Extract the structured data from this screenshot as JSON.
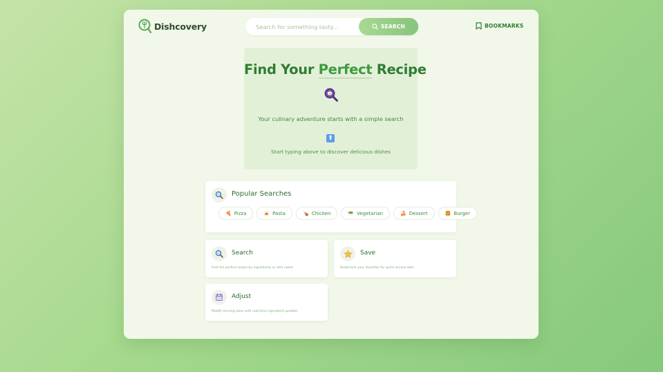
{
  "app": {
    "name": "Dishcovery"
  },
  "header": {
    "search_placeholder": "Search for something tasty...",
    "search_button": "SEARCH",
    "bookmarks_label": "BOOKMARKS"
  },
  "hero": {
    "title_part1": "Find Your ",
    "title_highlight": "Perfect",
    "title_part3": " Recipe",
    "subtitle": "Your culinary adventure starts with a simple search",
    "arrow_glyph": "⬆",
    "hint": "Start typing above to discover delicious dishes"
  },
  "popular": {
    "title": "Popular Searches",
    "chips": [
      {
        "label": "Pizza",
        "icon": "🍕"
      },
      {
        "label": "Pasta",
        "icon": "🍝"
      },
      {
        "label": "Chicken",
        "icon": "🍗"
      },
      {
        "label": "Vegetarian",
        "icon": "🥗"
      },
      {
        "label": "Dessert",
        "icon": "🍰"
      },
      {
        "label": "Burger",
        "icon": "🍔"
      }
    ]
  },
  "features": [
    {
      "title": "Search",
      "desc": "Find the perfect recipe by ingredients or dish name",
      "icon": "search-icon"
    },
    {
      "title": "Save",
      "desc": "Bookmark your favorites for quick access later",
      "icon": "star-icon"
    },
    {
      "title": "Adjust",
      "desc": "Modify serving sizes with real-time ingredient updates",
      "icon": "calendar-icon"
    }
  ],
  "colors": {
    "primary": "#2e7d32",
    "accent": "#87c47c",
    "panel": "#f1f8e9"
  }
}
